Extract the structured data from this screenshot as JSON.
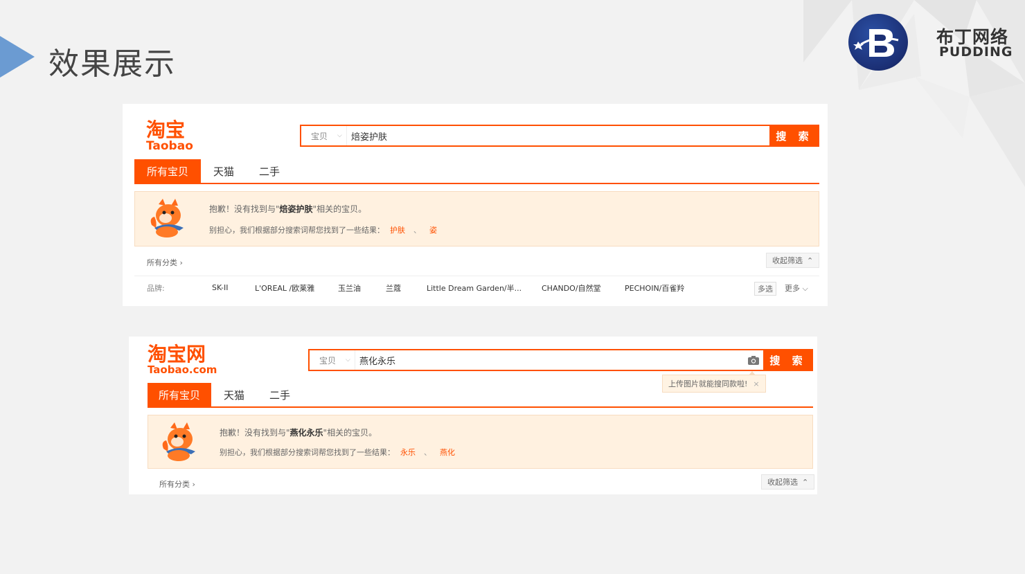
{
  "slide": {
    "title": "效果展示"
  },
  "brand": {
    "name_cn": "布丁网络",
    "name_en": "PUDDING"
  },
  "colors": {
    "accent": "#ff5000",
    "notice_bg": "#fff1e0",
    "slide_arrow": "#6b9bd2"
  },
  "panel1": {
    "logo_cn": "淘宝",
    "logo_en": "Taobao",
    "search": {
      "type": "宝贝",
      "query": "焙姿护肤",
      "button": "搜 索"
    },
    "tabs": [
      "所有宝贝",
      "天猫",
      "二手"
    ],
    "notice": {
      "line1_prefix": "抱歉！没有找到与\"",
      "keyword": "焙姿护肤",
      "line1_suffix": "\"相关的宝贝。",
      "line2_prefix": "别担心，我们根据部分搜索词帮您找到了一些结果：",
      "suggestions": [
        "护肤",
        "姿"
      ],
      "separator": "、"
    },
    "category_label": "所有分类",
    "collapse_label": "收起筛选",
    "brand_filter": {
      "label": "品牌:",
      "items": [
        "SK-II",
        "L'OREAL /欧莱雅",
        "玉兰油",
        "兰蔻",
        "Little Dream Garden/半...",
        "CHANDO/自然堂",
        "PECHOIN/百雀羚"
      ],
      "multi_label": "多选",
      "more_label": "更多"
    }
  },
  "panel2": {
    "logo_cn": "淘宝网",
    "logo_en": "Taobao.com",
    "search": {
      "type": "宝贝",
      "query": "燕化永乐",
      "button": "搜 索"
    },
    "tooltip": "上传图片就能搜同款啦!",
    "tooltip_close": "×",
    "tabs": [
      "所有宝贝",
      "天猫",
      "二手"
    ],
    "notice": {
      "line1_prefix": "抱歉！没有找到与\"",
      "keyword": "燕化永乐",
      "line1_suffix": "\"相关的宝贝。",
      "line2_prefix": "别担心，我们根据部分搜索词帮您找到了一些结果：",
      "suggestions": [
        "永乐",
        "燕化"
      ],
      "separator": "、"
    },
    "category_label": "所有分类",
    "collapse_label": "收起筛选"
  }
}
